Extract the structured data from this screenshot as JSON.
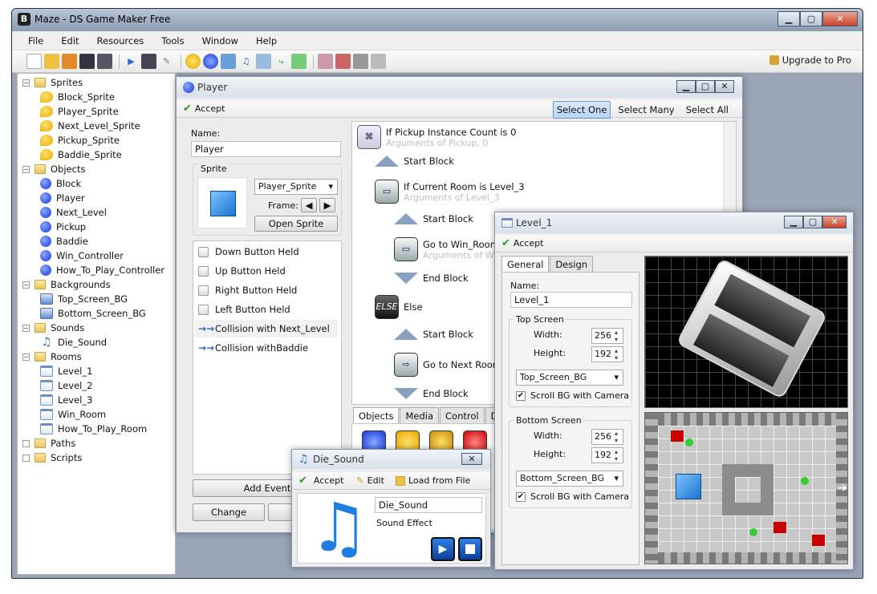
{
  "app": {
    "title": "Maze - DS Game Maker Free",
    "upgrade": "Upgrade to Pro"
  },
  "menu": [
    "File",
    "Edit",
    "Resources",
    "Tools",
    "Window",
    "Help"
  ],
  "tree": {
    "groups": [
      {
        "label": "Sprites",
        "items": [
          "Block_Sprite",
          "Player_Sprite",
          "Next_Level_Sprite",
          "Pickup_Sprite",
          "Baddie_Sprite"
        ]
      },
      {
        "label": "Objects",
        "items": [
          "Block",
          "Player",
          "Next_Level",
          "Pickup",
          "Baddie",
          "Win_Controller",
          "How_To_Play_Controller"
        ]
      },
      {
        "label": "Backgrounds",
        "items": [
          "Top_Screen_BG",
          "Bottom_Screen_BG"
        ]
      },
      {
        "label": "Sounds",
        "items": [
          "Die_Sound"
        ]
      },
      {
        "label": "Rooms",
        "items": [
          "Level_1",
          "Level_2",
          "Level_3",
          "Win_Room",
          "How_To_Play_Room"
        ]
      },
      {
        "label": "Paths",
        "items": []
      },
      {
        "label": "Scripts",
        "items": []
      }
    ]
  },
  "player": {
    "title": "Player",
    "accept": "Accept",
    "select_one": "Select One",
    "select_many": "Select Many",
    "select_all": "Select All",
    "name_label": "Name:",
    "name_value": "Player",
    "sprite_label": "Sprite",
    "sprite_value": "Player_Sprite",
    "frame_label": "Frame:",
    "open_sprite": "Open Sprite",
    "events": [
      "Down Button Held",
      "Up Button Held",
      "Right Button Held",
      "Left Button Held",
      "Collision with Next_Level",
      "Collision withBaddie"
    ],
    "add_event": "Add Event",
    "change": "Change",
    "actions": {
      "a1": "If Pickup Instance Count is 0",
      "a1s": "Arguments of Pickup, 0",
      "start": "Start Block",
      "a2": "If Current Room is Level_3",
      "a2s": "Arguments of Level_3",
      "a3": "Go to Win_Room",
      "a3s": "Arguments of Win",
      "end": "End Block",
      "else_icon": "ELSE",
      "else": "Else",
      "a4": "Go to Next Room"
    },
    "tabs": [
      "Objects",
      "Media",
      "Control",
      "Display"
    ]
  },
  "sound": {
    "title": "Die_Sound",
    "accept": "Accept",
    "edit": "Edit",
    "load": "Load from File",
    "name": "Die_Sound",
    "type": "Sound Effect"
  },
  "room": {
    "title": "Level_1",
    "accept": "Accept",
    "tabs": [
      "General",
      "Design"
    ],
    "name_label": "Name:",
    "name": "Level_1",
    "top": {
      "group": "Top Screen",
      "width_label": "Width:",
      "width": "256",
      "height_label": "Height:",
      "height": "192",
      "bg": "Top_Screen_BG",
      "scroll": "Scroll BG with Camera"
    },
    "bottom": {
      "group": "Bottom Screen",
      "width_label": "Width:",
      "width": "256",
      "height_label": "Height:",
      "height": "192",
      "bg": "Bottom_Screen_BG",
      "scroll": "Scroll BG with Camera"
    }
  }
}
